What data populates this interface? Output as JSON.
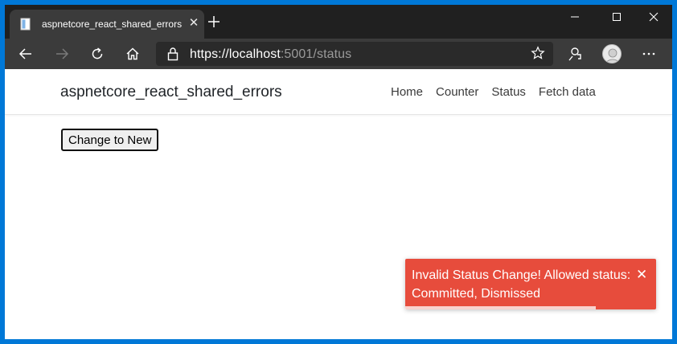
{
  "browser": {
    "tab_title": "aspnetcore_react_shared_errors",
    "tab_close": "✕",
    "url_scheme": "https://",
    "url_host": "localhost",
    "url_rest": ":5001/status"
  },
  "app": {
    "brand": "aspnetcore_react_shared_errors",
    "nav": [
      {
        "label": "Home"
      },
      {
        "label": "Counter"
      },
      {
        "label": "Status"
      },
      {
        "label": "Fetch data"
      }
    ],
    "change_button_label": "Change to New"
  },
  "toast": {
    "message": "Invalid Status Change! Allowed status: Committed, Dismissed",
    "close_label": "✕",
    "remaining_fraction": 0.76,
    "color": "#e74c3c"
  }
}
